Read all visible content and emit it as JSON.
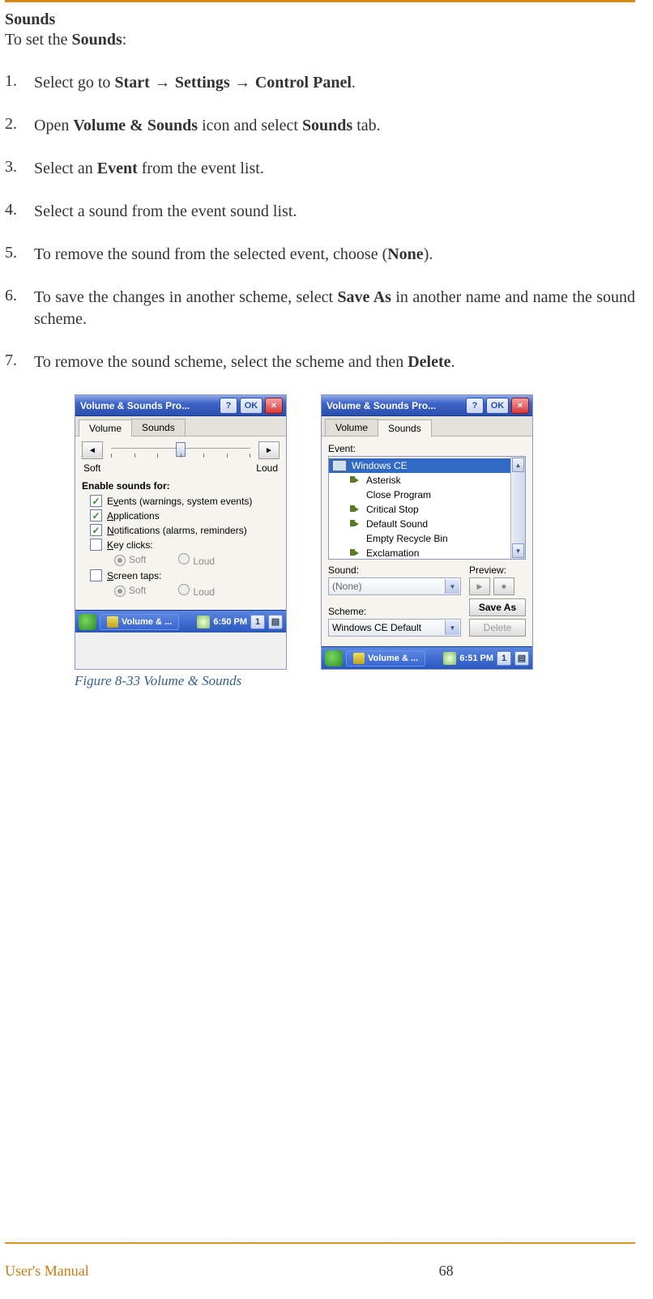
{
  "page": {
    "heading": "Sounds",
    "intro_pre": "To set the ",
    "intro_bold": "Sounds",
    "intro_post": ":"
  },
  "steps": [
    {
      "n": "1.",
      "parts": [
        {
          "t": "Select go to "
        },
        {
          "t": "Start",
          "b": true
        },
        {
          "t": " → ",
          "arrow": true
        },
        {
          "t": " Settings",
          "b": true
        },
        {
          "t": " → ",
          "arrow": true
        },
        {
          "t": " Control Panel",
          "b": true
        },
        {
          "t": "."
        }
      ]
    },
    {
      "n": "2.",
      "parts": [
        {
          "t": "Open "
        },
        {
          "t": "Volume & Sounds",
          "b": true
        },
        {
          "t": " icon and select "
        },
        {
          "t": "Sounds",
          "b": true
        },
        {
          "t": " tab."
        }
      ]
    },
    {
      "n": "3.",
      "parts": [
        {
          "t": "Select an "
        },
        {
          "t": "Event",
          "b": true
        },
        {
          "t": " from the event list."
        }
      ]
    },
    {
      "n": "4.",
      "parts": [
        {
          "t": "Select a sound from the event sound list."
        }
      ]
    },
    {
      "n": "5.",
      "parts": [
        {
          "t": "To remove the sound from the selected event, choose ("
        },
        {
          "t": "None",
          "b": true
        },
        {
          "t": ")."
        }
      ]
    },
    {
      "n": "6.",
      "parts": [
        {
          "t": "To save the changes in another scheme, select "
        },
        {
          "t": "Save As",
          "b": true
        },
        {
          "t": " in another name and name the sound scheme."
        }
      ]
    },
    {
      "n": "7.",
      "parts": [
        {
          "t": "To remove the sound scheme, select the scheme and then "
        },
        {
          "t": "Delete",
          "b": true
        },
        {
          "t": "."
        }
      ]
    }
  ],
  "figcap": "Figure 8-33 Volume & Sounds",
  "footer": {
    "left": "User's Manual",
    "page": "68"
  },
  "win1": {
    "title": "Volume & Sounds Pro...",
    "help": "?",
    "ok": "OK",
    "close": "×",
    "tabs": {
      "volume": "Volume",
      "sounds": "Sounds"
    },
    "slider": {
      "left": "◄",
      "right": "►",
      "soft": "Soft",
      "loud": "Loud"
    },
    "group": "Enable sounds for:",
    "chk": {
      "events": {
        "pre": "E",
        "u": "v",
        "post": "ents (warnings, system events)",
        "checked": true
      },
      "apps": {
        "pre": "",
        "u": "A",
        "post": "pplications",
        "checked": true
      },
      "notif": {
        "pre": "",
        "u": "N",
        "post": "otifications (alarms, reminders)",
        "checked": true
      },
      "keys": {
        "pre": "",
        "u": "K",
        "post": "ey clicks:",
        "checked": false
      },
      "screen": {
        "pre": "",
        "u": "S",
        "post": "creen taps:",
        "checked": false
      }
    },
    "radio": {
      "soft": "Soft",
      "loud": "Loud"
    },
    "task": {
      "app": "Volume & ...",
      "time": "6:50 PM",
      "num": "1"
    }
  },
  "win2": {
    "title": "Volume & Sounds Pro...",
    "help": "?",
    "ok": "OK",
    "close": "×",
    "tabs": {
      "volume": "Volume",
      "sounds": "Sounds"
    },
    "event_label": "Event:",
    "events": [
      {
        "label": "Windows CE",
        "icon": "monitor",
        "sel": true,
        "root": true
      },
      {
        "label": "Asterisk",
        "icon": "speaker"
      },
      {
        "label": "Close Program",
        "icon": "none"
      },
      {
        "label": "Critical Stop",
        "icon": "speaker"
      },
      {
        "label": "Default Sound",
        "icon": "speaker"
      },
      {
        "label": "Empty Recycle Bin",
        "icon": "none"
      },
      {
        "label": "Exclamation",
        "icon": "speaker"
      }
    ],
    "sound_label": "Sound:",
    "sound_value": "(None)",
    "preview_label": "Preview:",
    "scheme_label": "Scheme:",
    "scheme_value": "Windows CE Default",
    "saveas": "Save As",
    "delete": "Delete",
    "task": {
      "app": "Volume & ...",
      "time": "6:51 PM",
      "num": "1"
    }
  }
}
